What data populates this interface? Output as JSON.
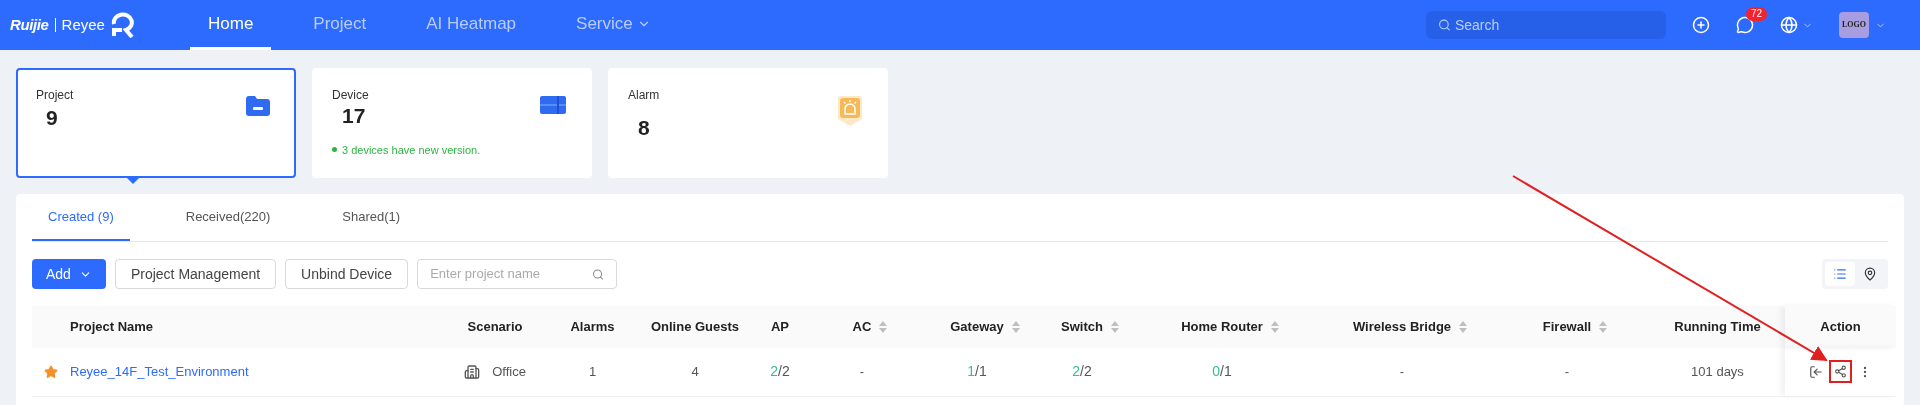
{
  "header": {
    "logo": {
      "brand": "Ruijie",
      "product": "Reyee"
    },
    "nav": [
      {
        "label": "Home",
        "selected": true,
        "dropdown": false
      },
      {
        "label": "Project",
        "selected": false,
        "dropdown": false
      },
      {
        "label": "AI Heatmap",
        "selected": false,
        "dropdown": false
      },
      {
        "label": "Service",
        "selected": false,
        "dropdown": true
      }
    ],
    "search": {
      "placeholder": "Search"
    },
    "notifications": {
      "badge": "72"
    },
    "avatar": {
      "label": "LOGO"
    }
  },
  "cards": [
    {
      "kind": "project",
      "label": "Project",
      "value": "9",
      "selected": true
    },
    {
      "kind": "device",
      "label": "Device",
      "value": "17",
      "note": "3 devices have new version.",
      "selected": false
    },
    {
      "kind": "alarm",
      "label": "Alarm",
      "value": "8",
      "selected": false
    }
  ],
  "tabs": [
    {
      "label": "Created (9)",
      "selected": true
    },
    {
      "label": "Received(220)",
      "selected": false
    },
    {
      "label": "Shared(1)",
      "selected": false
    }
  ],
  "toolbar": {
    "add": "Add",
    "buttons": [
      "Project Management",
      "Unbind Device"
    ],
    "search": {
      "placeholder": "Enter project name"
    },
    "views": [
      {
        "kind": "list",
        "selected": true
      },
      {
        "kind": "map",
        "selected": false
      }
    ]
  },
  "table": {
    "columns": [
      {
        "label": "Project Name",
        "sortable": false
      },
      {
        "label": "Scenario",
        "sortable": false
      },
      {
        "label": "Alarms",
        "sortable": false
      },
      {
        "label": "Online Guests",
        "sortable": false
      },
      {
        "label": "AP",
        "sortable": false
      },
      {
        "label": "AC",
        "sortable": true
      },
      {
        "label": "Gateway",
        "sortable": true
      },
      {
        "label": "Switch",
        "sortable": true
      },
      {
        "label": "Home Router",
        "sortable": true
      },
      {
        "label": "Wireless Bridge",
        "sortable": true
      },
      {
        "label": "Firewall",
        "sortable": true
      },
      {
        "label": "Running Time",
        "sortable": false
      },
      {
        "label": "Action",
        "sortable": false
      }
    ],
    "rows": [
      {
        "starred": true,
        "name": "Reyee_14F_Test_Environment",
        "scenario": "Office",
        "alarms": "1",
        "online_guests": "4",
        "ap": {
          "online": "2",
          "rest": "/2"
        },
        "ac": "-",
        "gateway": {
          "online": "1",
          "rest": "/1"
        },
        "switch": {
          "online": "2",
          "rest": "/2"
        },
        "home_router": {
          "online": "0",
          "rest": "/1"
        },
        "wireless_bridge": "-",
        "firewall": "-",
        "running_time": "101 days",
        "share_highlighted": true
      }
    ]
  }
}
